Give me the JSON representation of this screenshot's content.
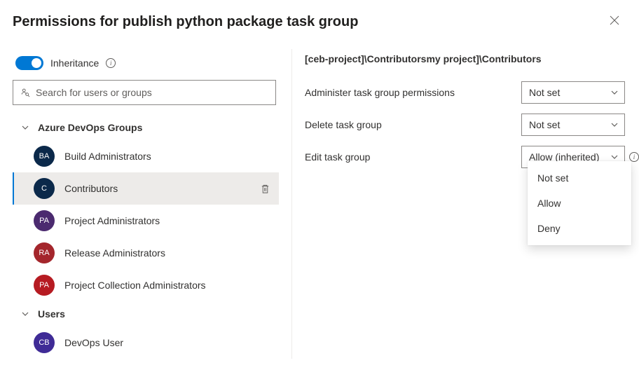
{
  "header": {
    "title": "Permissions for publish python package task group"
  },
  "inheritance": {
    "label": "Inheritance",
    "enabled": true
  },
  "search": {
    "placeholder": "Search for users or groups"
  },
  "sections": {
    "groups": {
      "title": "Azure DevOps Groups",
      "items": [
        {
          "initials": "BA",
          "label": "Build Administrators",
          "avatar": "navy",
          "selected": false
        },
        {
          "initials": "C",
          "label": "Contributors",
          "avatar": "navy",
          "selected": true
        },
        {
          "initials": "PA",
          "label": "Project Administrators",
          "avatar": "purple",
          "selected": false
        },
        {
          "initials": "RA",
          "label": "Release Administrators",
          "avatar": "red",
          "selected": false
        },
        {
          "initials": "PA",
          "label": "Project Collection Administrators",
          "avatar": "red2",
          "selected": false
        }
      ]
    },
    "users": {
      "title": "Users",
      "items": [
        {
          "initials": "CB",
          "label": "DevOps User",
          "avatar": "vio"
        }
      ]
    }
  },
  "details": {
    "breadcrumb": "[ceb-project]\\Contributorsmy project]\\Contributors",
    "permissions": [
      {
        "label": "Administer task group permissions",
        "value": "Not set",
        "inherited": false
      },
      {
        "label": "Delete task group",
        "value": "Not set",
        "inherited": false
      },
      {
        "label": "Edit task group",
        "value": "Allow (inherited)",
        "inherited": true
      }
    ],
    "dropdown_options": [
      "Not set",
      "Allow",
      "Deny"
    ]
  }
}
